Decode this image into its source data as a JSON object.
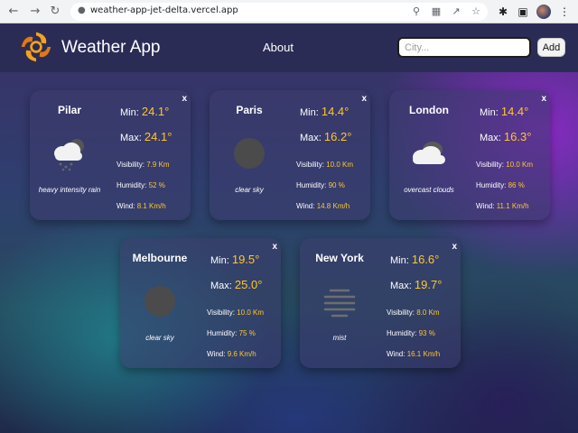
{
  "browser": {
    "url": "weather-app-jet-delta.vercel.app",
    "back_icon": "arrow-left-icon",
    "forward_icon": "arrow-right-icon",
    "reload_icon": "reload-icon"
  },
  "app": {
    "brand": "Weather App",
    "nav": {
      "about": "About"
    },
    "search": {
      "placeholder": "City...",
      "value": ""
    },
    "add_label": "Add"
  },
  "cards": [
    {
      "city": "Pilar",
      "min_label": "Min:",
      "min": "24.1°",
      "max_label": "Max:",
      "max": "24.1°",
      "visibility_label": "Visibility:",
      "visibility": "7.9 Km",
      "humidity_label": "Humidity:",
      "humidity": "52 %",
      "wind_label": "Wind:",
      "wind": "8.1 Km/h",
      "description": "heavy intensity rain",
      "icon": "rain-cloud-icon",
      "close": "x"
    },
    {
      "city": "Paris",
      "min_label": "Min:",
      "min": "14.4°",
      "max_label": "Max:",
      "max": "16.2°",
      "visibility_label": "Visibility:",
      "visibility": "10.0 Km",
      "humidity_label": "Humidity:",
      "humidity": "90 %",
      "wind_label": "Wind:",
      "wind": "14.8 Km/h",
      "description": "clear sky",
      "icon": "clear-sky-icon",
      "close": "x"
    },
    {
      "city": "London",
      "min_label": "Min:",
      "min": "14.4°",
      "max_label": "Max:",
      "max": "16.3°",
      "visibility_label": "Visibility:",
      "visibility": "10.0 Km",
      "humidity_label": "Humidity:",
      "humidity": "86 %",
      "wind_label": "Wind:",
      "wind": "11.1 Km/h",
      "description": "overcast clouds",
      "icon": "overcast-clouds-icon",
      "close": "x"
    },
    {
      "city": "Melbourne",
      "min_label": "Min:",
      "min": "19.5°",
      "max_label": "Max:",
      "max": "25.0°",
      "visibility_label": "Visibility:",
      "visibility": "10.0 Km",
      "humidity_label": "Humidity:",
      "humidity": "75 %",
      "wind_label": "Wind:",
      "wind": "9.6 Km/h",
      "description": "clear sky",
      "icon": "clear-sky-icon",
      "close": "x"
    },
    {
      "city": "New York",
      "min_label": "Min:",
      "min": "16.6°",
      "max_label": "Max:",
      "max": "19.7°",
      "visibility_label": "Visibility:",
      "visibility": "8.0 Km",
      "humidity_label": "Humidity:",
      "humidity": "93 %",
      "wind_label": "Wind:",
      "wind": "16.1 Km/h",
      "description": "mist",
      "icon": "mist-icon",
      "close": "x"
    }
  ],
  "colors": {
    "accent": "#ffc62e",
    "topbar": "#2b2c55"
  }
}
